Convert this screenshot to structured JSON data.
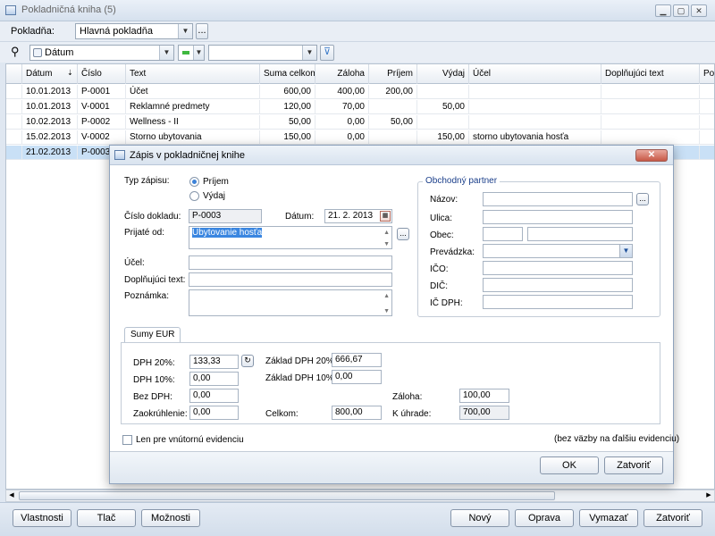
{
  "window": {
    "title": "Pokladničná kniha (5)"
  },
  "cashbox": {
    "label": "Pokladňa:",
    "value": "Hlavná pokladňa",
    "more": "..."
  },
  "filter": {
    "field": "Dátum",
    "value": ""
  },
  "grid": {
    "columns": [
      "Dátum",
      "Číslo",
      "Text",
      "Suma celkom",
      "Záloha",
      "Príjem",
      "Výdaj",
      "Účel",
      "Doplňujúci text",
      "Po"
    ],
    "rows": [
      [
        "10.01.2013",
        "P-0001",
        "Účet",
        "600,00",
        "400,00",
        "200,00",
        "",
        "",
        ""
      ],
      [
        "10.01.2013",
        "V-0001",
        "Reklamné predmety",
        "120,00",
        "70,00",
        "",
        "50,00",
        "",
        ""
      ],
      [
        "10.02.2013",
        "P-0002",
        "Wellness - II",
        "50,00",
        "0,00",
        "50,00",
        "",
        "",
        ""
      ],
      [
        "15.02.2013",
        "V-0002",
        "Storno ubytovania",
        "150,00",
        "0,00",
        "",
        "150,00",
        "storno ubytovania hosťa",
        ""
      ],
      [
        "21.02.2013",
        "P-0003",
        "",
        "",
        "",
        "",
        "",
        "",
        ""
      ]
    ]
  },
  "bottom_buttons": {
    "properties": "Vlastnosti",
    "print": "Tlač",
    "options": "Možnosti",
    "new": "Nový",
    "edit": "Oprava",
    "delete": "Vymazať",
    "close": "Zatvoriť"
  },
  "dialog": {
    "title": "Zápis v pokladničnej knihe",
    "close_glyph": "✕",
    "type_label": "Typ zápisu:",
    "type_options": [
      "Príjem",
      "Výdaj"
    ],
    "doc_no_label": "Číslo dokladu:",
    "doc_no": "P-0003",
    "date_label": "Dátum:",
    "date": "21. 2. 2013",
    "received_from_label": "Prijaté od:",
    "received_from": "Ubytovanie hosťa",
    "purpose_label": "Účel:",
    "purpose": "",
    "extra_label": "Doplňujúci text:",
    "extra": "",
    "note_label": "Poznámka:",
    "note": "",
    "partner": {
      "title": "Obchodný partner",
      "name_label": "Názov:",
      "street_label": "Ulica:",
      "city_label": "Obec:",
      "branch_label": "Prevádzka:",
      "ico_label": "IČO:",
      "dic_label": "DIČ:",
      "icdph_label": "IČ DPH:",
      "more": "..."
    },
    "tab": "Sumy EUR",
    "sums": {
      "vat20_label": "DPH 20%:",
      "vat20": "133,33",
      "vat10_label": "DPH 10%:",
      "vat10": "0,00",
      "novat_label": "Bez DPH:",
      "novat": "0,00",
      "rounding_label": "Zaokrúhlenie:",
      "rounding": "0,00",
      "base20_label": "Základ DPH 20%:",
      "base20": "666,67",
      "base10_label": "Základ DPH 10%:",
      "base10": "0,00",
      "total_label": "Celkom:",
      "total": "800,00",
      "advance_label": "Záloha:",
      "advance": "100,00",
      "topay_label": "K úhrade:",
      "topay": "700,00"
    },
    "internal_label": "Len pre vnútornú evidenciu",
    "internal_note": "(bez väzby na ďalšiu evidenciu)",
    "ok": "OK",
    "close": "Zatvoriť"
  }
}
